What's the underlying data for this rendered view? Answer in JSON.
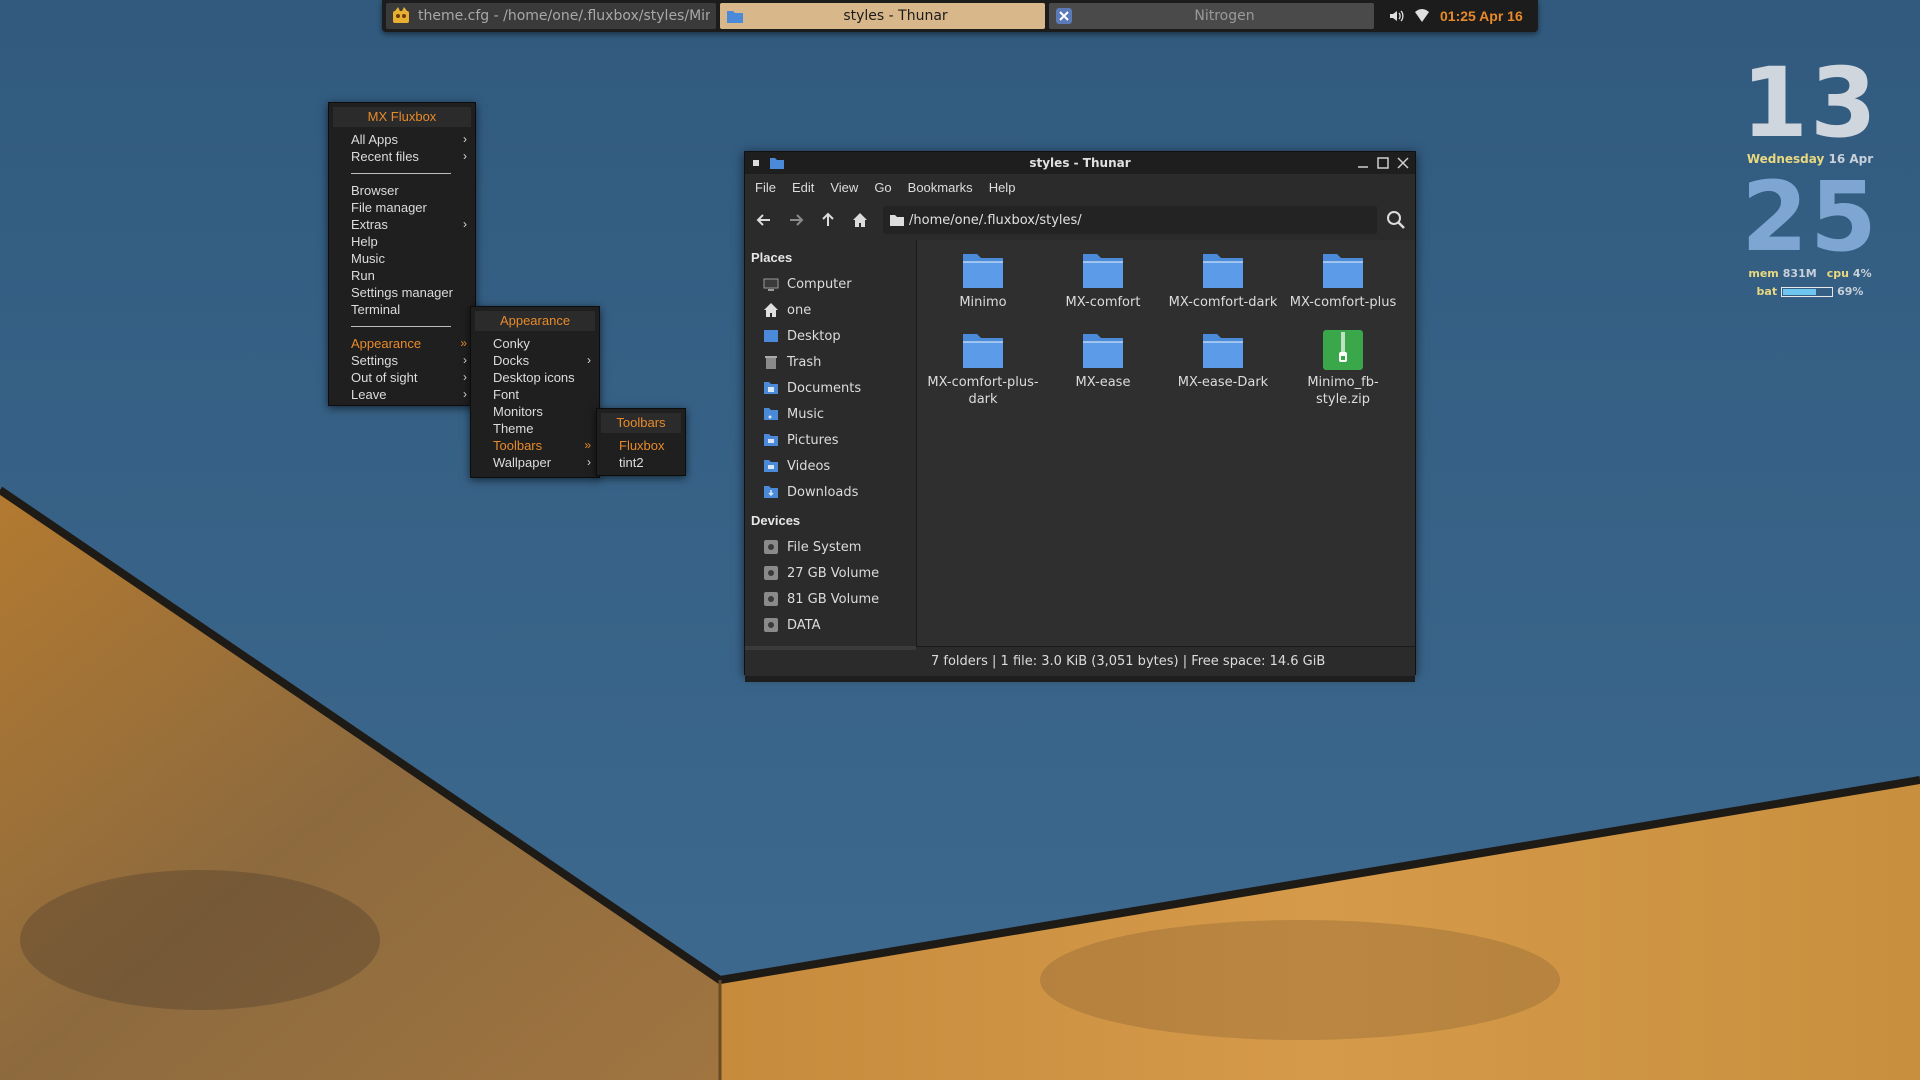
{
  "taskbar": {
    "tasks": [
      {
        "label": "theme.cfg - /home/one/.fluxbox/styles/Minimo",
        "icon": "editor-icon"
      },
      {
        "label": "styles - Thunar",
        "icon": "folder-icon"
      },
      {
        "label": "Nitrogen",
        "icon": "nitrogen-icon"
      }
    ],
    "clock": "01:25  Apr 16"
  },
  "conky": {
    "hour": "13",
    "day_name": "Wednesday",
    "day_date": "16 Apr",
    "minute": "25",
    "mem_label": "mem",
    "mem_value": "831M",
    "cpu_label": "cpu",
    "cpu_value": "4%",
    "bat_label": "bat",
    "bat_value": "69%",
    "bat_level": 0.69
  },
  "menu_main": {
    "title": "MX Fluxbox",
    "group1": [
      "All Apps",
      "Recent files"
    ],
    "group2": [
      "Browser",
      "File manager",
      "Extras",
      "Help",
      "Music",
      "Run",
      "Settings manager",
      "Terminal"
    ],
    "group3": [
      "Appearance",
      "Settings",
      "Out of sight",
      "Leave"
    ]
  },
  "menu_appearance": {
    "title": "Appearance",
    "items": [
      "Conky",
      "Docks",
      "Desktop icons",
      "Font",
      "Monitors",
      "Theme",
      "Toolbars",
      "Wallpaper"
    ]
  },
  "menu_toolbars": {
    "title": "Toolbars",
    "items": [
      "Fluxbox",
      "tint2"
    ]
  },
  "thunar": {
    "title": "styles - Thunar",
    "menubar": [
      "File",
      "Edit",
      "View",
      "Go",
      "Bookmarks",
      "Help"
    ],
    "path": "/home/one/.fluxbox/styles/",
    "places_heading": "Places",
    "places": [
      "Computer",
      "one",
      "Desktop",
      "Trash",
      "Documents",
      "Music",
      "Pictures",
      "Videos",
      "Downloads"
    ],
    "devices_heading": "Devices",
    "devices": [
      "File System",
      "27 GB Volume",
      "81 GB Volume",
      "DATA"
    ],
    "files": [
      "Minimo",
      "MX-comfort",
      "MX-comfort-dark",
      "MX-comfort-plus",
      "MX-comfort-plus-dark",
      "MX-ease",
      "MX-ease-Dark",
      "Minimo_fb-style.zip"
    ],
    "status": "7 folders  |  1 file: 3.0 KiB (3,051 bytes)  |  Free space: 14.6 GiB"
  },
  "colors": {
    "sky": "#3a6285",
    "wall": "#c48a3a",
    "accent": "#e88a2a",
    "folder": "#5b9be8"
  }
}
